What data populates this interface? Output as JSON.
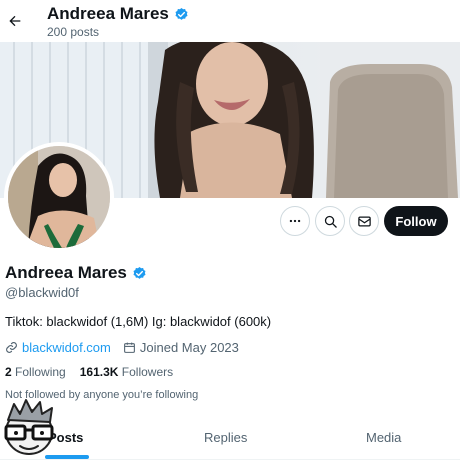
{
  "header": {
    "name": "Andreea Mares",
    "posts_count": "200 posts",
    "back_icon": "arrow-left-icon"
  },
  "profile": {
    "name": "Andreea Mares",
    "handle": "@blackwid0f",
    "bio": "Tiktok: blackwidof (1,6M) Ig: blackwidof (600k)",
    "website": "blackwidof.com",
    "joined": "Joined May 2023",
    "following_count": "2",
    "following_label": "Following",
    "followers_count": "161.3K",
    "followers_label": "Followers",
    "not_followed_text": "Not followed by anyone you’re following",
    "verified_icon": "verified-badge-icon"
  },
  "actions": {
    "more_icon": "more-horizontal-icon",
    "search_icon": "search-icon",
    "message_icon": "envelope-icon",
    "follow_label": "Follow"
  },
  "tabs": [
    {
      "label": "Posts",
      "active": true
    },
    {
      "label": "Replies",
      "active": false
    },
    {
      "label": "Media",
      "active": false
    }
  ],
  "colors": {
    "accent": "#1d9bf0",
    "text_primary": "#0f1419",
    "text_secondary": "#536471",
    "follow_button_bg": "#0f1419"
  }
}
